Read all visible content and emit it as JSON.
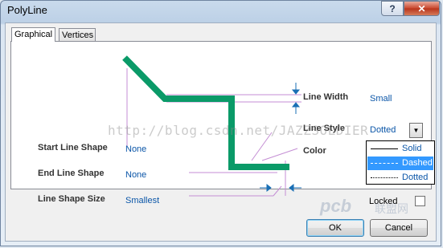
{
  "window": {
    "title": "PolyLine",
    "help_label": "?",
    "close_label": "✕"
  },
  "tabs": [
    {
      "label": "Graphical",
      "active": true
    },
    {
      "label": "Vertices",
      "active": false
    }
  ],
  "properties": {
    "line_width": {
      "label": "Line Width",
      "value": "Small"
    },
    "line_style": {
      "label": "Line Style",
      "value": "Dotted"
    },
    "color": {
      "label": "Color"
    },
    "start_line_shape": {
      "label": "Start Line Shape",
      "value": "None"
    },
    "end_line_shape": {
      "label": "End Line Shape",
      "value": "None"
    },
    "line_shape_size": {
      "label": "Line Shape Size",
      "value": "Smallest"
    },
    "locked": {
      "label": "Locked",
      "checked": false
    }
  },
  "line_style_dropdown": {
    "options": [
      "Solid",
      "Dashed",
      "Dotted"
    ],
    "selected": "Dashed"
  },
  "buttons": {
    "ok": "OK",
    "cancel": "Cancel"
  },
  "watermark": "http://blog.csdn.net/JAZZSOLDIER",
  "logo_text": "pcb",
  "logo_suffix": "联盟网",
  "colors": {
    "line": "#0a9a68",
    "value_text": "#0b56a8",
    "leader": "#c48ed4",
    "selection": "#3399ff"
  },
  "icons": [
    "help-icon",
    "close-icon",
    "dropdown-arrow-icon"
  ]
}
